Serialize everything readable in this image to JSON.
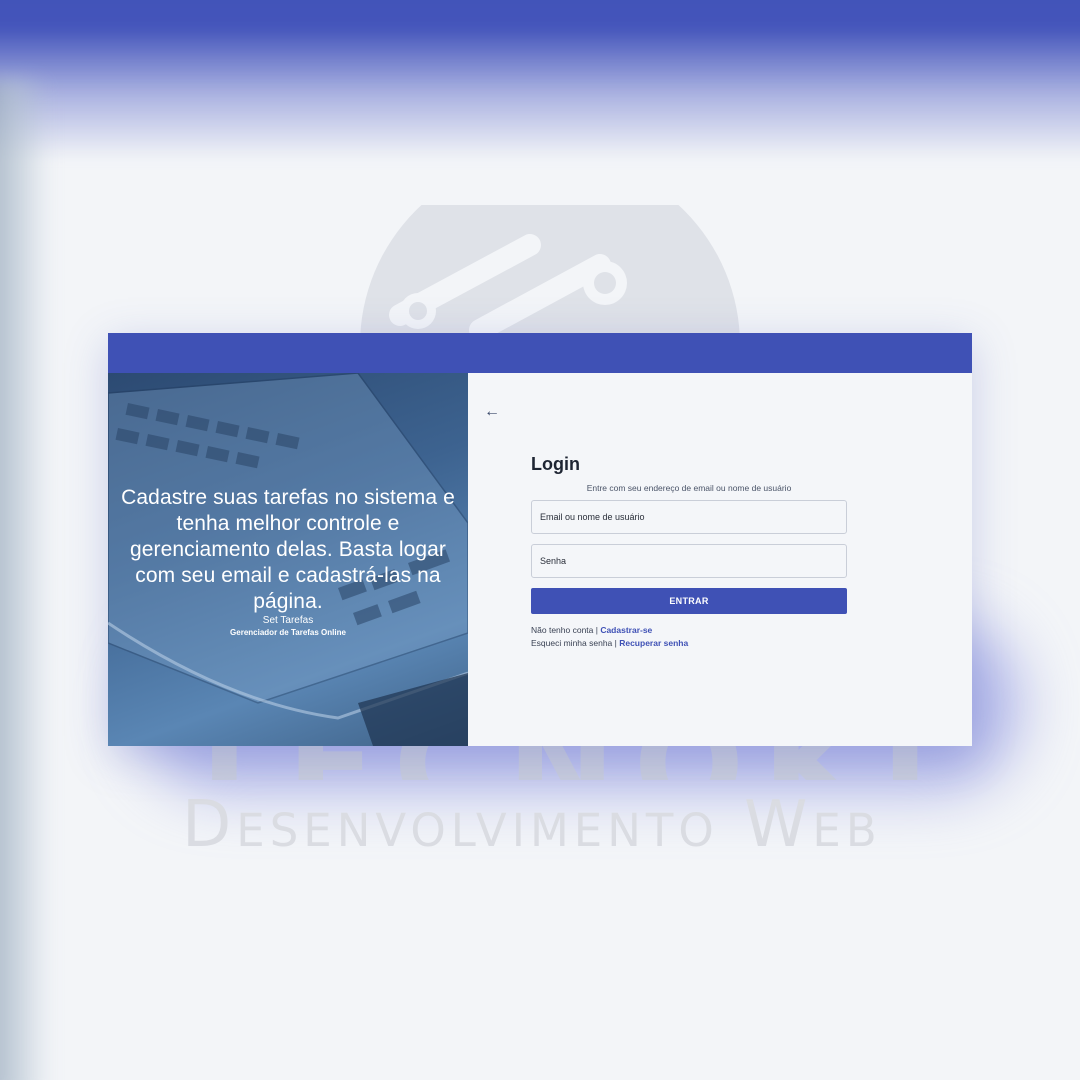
{
  "background": {
    "watermark_title": "TECNOKITT",
    "watermark_subtitle": "Desenvolvimento Web"
  },
  "hero": {
    "message": "Cadastre suas tarefas no sistema e tenha melhor controle e gerenciamento delas. Basta logar com seu email e cadastrá-las na página.",
    "brand": "Set Tarefas",
    "tagline": "Gerenciador de Tarefas Online"
  },
  "back": {
    "icon": "arrow-left-icon",
    "glyph": "←"
  },
  "login": {
    "title": "Login",
    "subtitle": "Entre com seu endereço de email ou nome de usuário",
    "email_placeholder": "Email ou nome de usuário",
    "password_placeholder": "Senha",
    "submit_label": "ENTRAR"
  },
  "links": {
    "no_account_text": "Não tenho conta | ",
    "register_label": "Cadastrar-se",
    "forgot_text": "Esqueci minha senha | ",
    "recover_label": "Recuperar senha"
  },
  "colors": {
    "primary": "#3f51b5",
    "page_background": "#f3f5f8"
  }
}
